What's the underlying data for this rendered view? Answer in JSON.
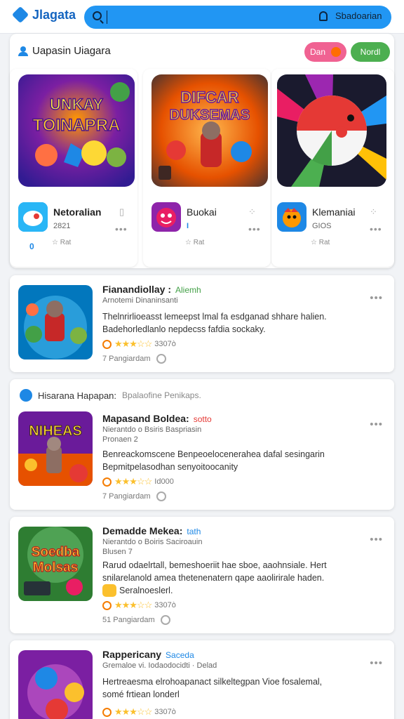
{
  "app": {
    "title": "Jlagata"
  },
  "search": {
    "placeholder": "",
    "button": "Sbadoarian"
  },
  "featured": {
    "title": "Uapasin Uiagara",
    "pill_left": "Dan",
    "pill_right": "Nordl",
    "cards": [
      {
        "art_text": "UNKAY TOINAPRA",
        "name": "Netoralian",
        "sub": "2821",
        "meta": "Rat",
        "badge": "0",
        "side": ""
      },
      {
        "art_text": "DIFCAR DUKSEMAS",
        "name": "Buokai",
        "sub": "",
        "meta": "Rat",
        "badge": "",
        "side": ""
      },
      {
        "art_text": "",
        "name": "Klemaniai",
        "sub": "GIOS",
        "meta": "Rat",
        "badge": "",
        "side": ""
      }
    ]
  },
  "list": [
    {
      "title": "Fianandiollay :",
      "tag": "Aliemh",
      "sub": "Arnotemi    Dinaninsanti",
      "desc": "Thelnrirlioeasst  lemeepst  lmal fa esdganad shhare  halien.\nBadehorledlanlo nepdecss fafdia  sockaky.",
      "rating": "3307ò",
      "foot": "7 Pangiardam"
    },
    {
      "header": "Hisarana Hapapan:",
      "header_sub": "Bpalaofine Penikaps.",
      "title": "Mapasand Boldea:",
      "tag": "sotto",
      "sub": "Nierantdo o Bsiris    Baspriasin",
      "sub2": "Pronaen 2",
      "desc": "Benreackomscene Benpeoelocenerahea dafal  sesingarin\nBepmitpelasodhan senyoitoocanity",
      "rating": "Id000",
      "foot": "7 Pangiardam"
    },
    {
      "title": "Demadde Mekea:",
      "tag": "tath",
      "sub": "Nierantdo o Boiris    Saciroauin",
      "sub2": "Blusen 7",
      "desc": "Rarud odaelrtall,  bemeshoeriit  hae  sboe,  aaohnsiale.  Hert\nsnilarelanold  amea  thetenenatern  qape aaolirirale haden.",
      "chip": "Seralnoeslerl.",
      "rating": "3307ò",
      "foot": "51 Pangiardam"
    },
    {
      "title": "Rappericany",
      "tag": "Saceda",
      "sub": "Gremaloe vi.  Iodaodocidti  ·  Delad",
      "desc": "Hertreaesma elrohoapanact silkeltegpan Vioe  fosalemal,\nsomé  frtiean  londerl",
      "rating": "3307ò",
      "foot": ""
    }
  ]
}
